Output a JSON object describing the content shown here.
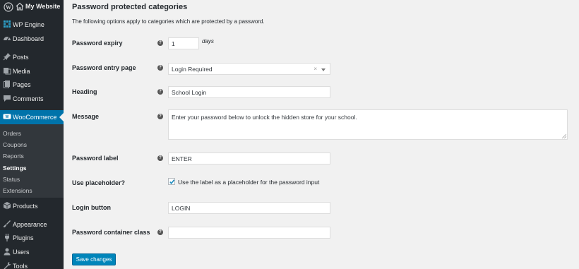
{
  "sidebar": {
    "site_name": "My Website",
    "menu": {
      "wp_engine": "WP Engine",
      "dashboard": "Dashboard",
      "posts": "Posts",
      "media": "Media",
      "pages": "Pages",
      "comments": "Comments",
      "woocommerce": "WooCommerce",
      "products": "Products",
      "appearance": "Appearance",
      "plugins": "Plugins",
      "users": "Users",
      "tools": "Tools"
    },
    "woocommerce_submenu": [
      "Orders",
      "Coupons",
      "Reports",
      "Settings",
      "Status",
      "Extensions"
    ],
    "current_submenu": "Settings"
  },
  "page": {
    "title": "Password protected categories",
    "intro": "The following options apply to categories which are protected by a password.",
    "fields": {
      "password_expiry": {
        "label": "Password expiry",
        "value": "1",
        "suffix": "days"
      },
      "password_entry_page": {
        "label": "Password entry page",
        "value": "Login Required"
      },
      "heading": {
        "label": "Heading",
        "value": "School Login"
      },
      "message": {
        "label": "Message",
        "value": "Enter your password below to unlock the hidden store for your school."
      },
      "password_label": {
        "label": "Password label",
        "value": "ENTER"
      },
      "use_placeholder": {
        "label": "Use placeholder?",
        "checkbox_label": "Use the label as a placeholder for the password input",
        "checked": true
      },
      "login_button": {
        "label": "Login button",
        "value": "LOGIN"
      },
      "password_container_class": {
        "label": "Password container class",
        "value": ""
      }
    },
    "save_label": "Save changes"
  },
  "colors": {
    "sidebar_bg": "#23282d",
    "active": "#0073aa",
    "button": "#0085ba",
    "page_bg": "#f1f1f1"
  }
}
